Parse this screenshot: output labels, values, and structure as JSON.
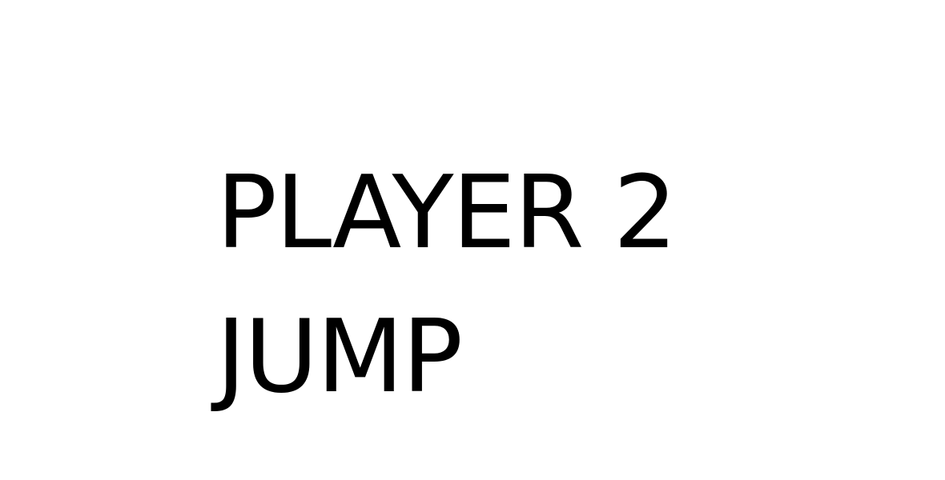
{
  "screen": {
    "background": "#ffffff",
    "text_color": "#000000"
  },
  "message": {
    "line1": "PLAYER 2",
    "line2": "JUMP"
  }
}
